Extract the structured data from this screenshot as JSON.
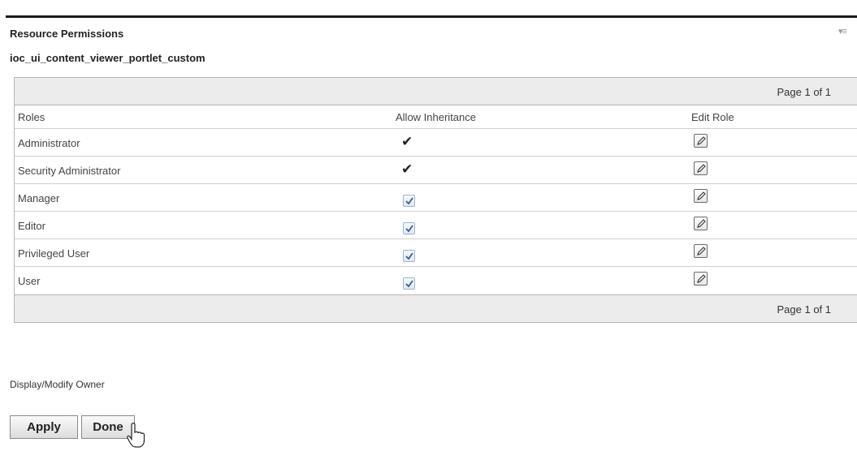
{
  "portlet": {
    "title": "Resource Permissions",
    "menu_icon": "menu-icon",
    "resource_name": "ioc_ui_content_viewer_portlet_custom"
  },
  "pager": {
    "top": "Page 1 of 1",
    "bottom": "Page 1 of 1"
  },
  "table": {
    "headers": {
      "roles": "Roles",
      "allow_inheritance": "Allow Inheritance",
      "edit_role": "Edit Role"
    },
    "rows": [
      {
        "role": "Administrator",
        "inheritance": "check-mark"
      },
      {
        "role": "Security Administrator",
        "inheritance": "check-mark"
      },
      {
        "role": "Manager",
        "inheritance": "checkbox-checked"
      },
      {
        "role": "Editor",
        "inheritance": "checkbox-checked"
      },
      {
        "role": "Privileged User",
        "inheritance": "checkbox-checked"
      },
      {
        "role": "User",
        "inheritance": "checkbox-checked"
      }
    ]
  },
  "links": {
    "display_modify_owner": "Display/Modify Owner"
  },
  "buttons": {
    "apply": "Apply",
    "done": "Done"
  },
  "colors": {
    "pager_background": "#ececec",
    "checkbox_border": "#9db4cf",
    "checkbox_check": "#3a5f8c"
  }
}
